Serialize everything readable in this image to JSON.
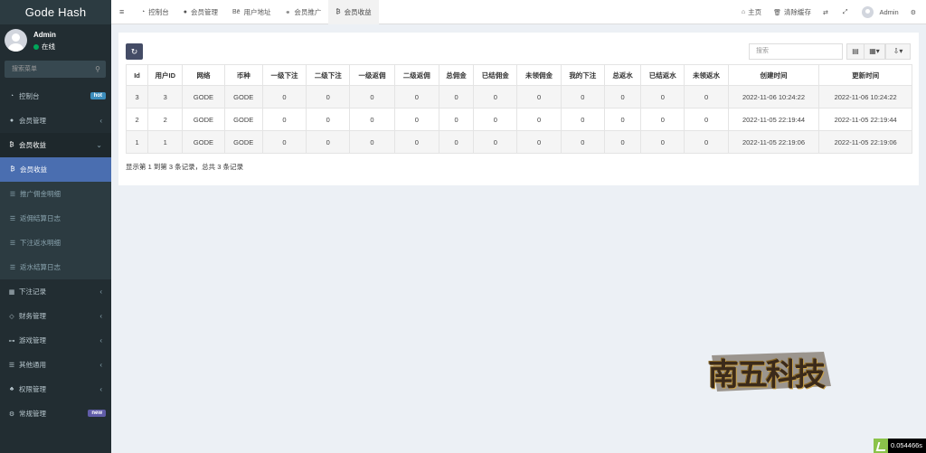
{
  "app": {
    "title": "Gode Hash"
  },
  "user": {
    "name": "Admin",
    "status": "在线"
  },
  "sidebar": {
    "search_placeholder": "搜索菜单",
    "items": [
      {
        "label": "控制台",
        "icon": "dashboard-icon",
        "badge": "hot"
      },
      {
        "label": "会员管理",
        "icon": "user-circle-icon"
      },
      {
        "label": "会员收益",
        "icon": "bitcoin-icon"
      },
      {
        "label": "会员收益",
        "icon": "bitcoin-icon"
      },
      {
        "label": "推广佣金明细",
        "icon": "list-icon"
      },
      {
        "label": "返佣结算日志",
        "icon": "list-icon"
      },
      {
        "label": "下注返水明细",
        "icon": "list-icon"
      },
      {
        "label": "返水结算日志",
        "icon": "list-icon"
      },
      {
        "label": "下注记录",
        "icon": "calendar-icon"
      },
      {
        "label": "财务管理",
        "icon": "diamond-icon"
      },
      {
        "label": "游戏管理",
        "icon": "gamepad-icon"
      },
      {
        "label": "其他通用",
        "icon": "list-icon"
      },
      {
        "label": "权限管理",
        "icon": "users-icon"
      },
      {
        "label": "常规管理",
        "icon": "cogs-icon",
        "badge": "new"
      }
    ]
  },
  "topbar": {
    "tabs": [
      "控制台",
      "会员管理",
      "用户地址",
      "会员推广",
      "会员收益"
    ],
    "right": {
      "home": "主页",
      "clear_cache": "清除缓存",
      "user": "Admin"
    }
  },
  "table": {
    "search_placeholder": "搜索",
    "columns": [
      "Id",
      "用户ID",
      "网络",
      "币种",
      "一级下注",
      "二级下注",
      "一级返佣",
      "二级返佣",
      "总佣金",
      "已结佣金",
      "未领佣金",
      "我的下注",
      "总返水",
      "已结返水",
      "未领返水",
      "创建时间",
      "更新时间"
    ],
    "rows": [
      [
        "3",
        "3",
        "GODE",
        "GODE",
        "0",
        "0",
        "0",
        "0",
        "0",
        "0",
        "0",
        "0",
        "0",
        "0",
        "0",
        "2022-11-06 10:24:22",
        "2022-11-06 10:24:22"
      ],
      [
        "2",
        "2",
        "GODE",
        "GODE",
        "0",
        "0",
        "0",
        "0",
        "0",
        "0",
        "0",
        "0",
        "0",
        "0",
        "0",
        "2022-11-05 22:19:44",
        "2022-11-05 22:19:44"
      ],
      [
        "1",
        "1",
        "GODE",
        "GODE",
        "0",
        "0",
        "0",
        "0",
        "0",
        "0",
        "0",
        "0",
        "0",
        "0",
        "0",
        "2022-11-05 22:19:06",
        "2022-11-05 22:19:06"
      ]
    ],
    "footer": "显示第 1 到第 3 条记录，总共 3 条记录"
  },
  "watermark": {
    "text": "南五科技"
  },
  "timer": {
    "value": "0.054466s"
  }
}
